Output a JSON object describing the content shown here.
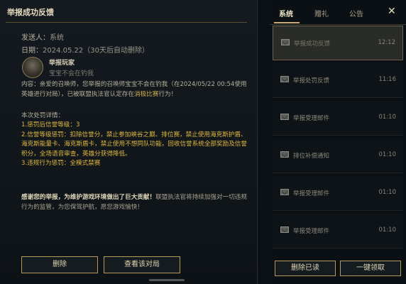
{
  "report": {
    "title": "举报成功反馈",
    "sender_label": "发送人：",
    "sender": "系统",
    "date_label": "日期：",
    "date": "2024.05.22（30天后自动删除）",
    "player_name": "举报玩家",
    "player_sub": "宝宝不会在钓我",
    "content_prefix": "内容：亲爱的召唤师，您举报的召唤师宝宝不会在钓我（在2024/05/22 00:54使用英雄进行对局），已被联盟执法官认定存在",
    "content_highlight": "消极比赛",
    "content_suffix": "行为！",
    "details_head": "本次处罚详情：",
    "details": [
      "1.惩罚后信誉等级：3",
      "2.信誉等级惩罚：扣除信誉分，禁止参加峡谷之巅、排位赛，禁止使用海克斯护盾、海克斯能量卡、海克斯盾卡，禁止使用不想同队功能，回收信誉系统全部奖励及信誉积分，全场语音审查，英雄分获得降低。",
      "3.违规行为惩罚：全模式禁赛"
    ],
    "thanks_bold": "感谢您的举报，为维护游戏环境做出了巨大贡献！",
    "thanks_rest": "联盟执法官将持续加强对一切违规行为的监管，为您保驾护航，愿您游戏愉快！",
    "delete_button": "删除",
    "view_button": "查看该对局"
  },
  "panel": {
    "tabs": [
      "系统",
      "赠礼",
      "公告"
    ],
    "active_tab": "系统",
    "close": "✕",
    "mails": [
      {
        "label": "举报成功反馈",
        "time": "12:12",
        "icon": "envelope-icon"
      },
      {
        "label": "举报处罚反馈",
        "time": "11:16",
        "icon": "envelope-icon"
      },
      {
        "label": "举报受理邮件",
        "time": "01:10",
        "icon": "envelope-icon"
      },
      {
        "label": "排位补偿通知",
        "time": "01:10",
        "icon": "envelope-icon"
      },
      {
        "label": "举报受理邮件",
        "time": "01:10",
        "icon": "envelope-icon"
      },
      {
        "label": "举报受理邮件",
        "time": "01:10",
        "icon": "envelope-icon"
      }
    ],
    "delete_read": "删除已读",
    "claim_all": "一键领取"
  },
  "colors": {
    "accent": "#c8aa6e",
    "highlight": "#e0b840"
  }
}
